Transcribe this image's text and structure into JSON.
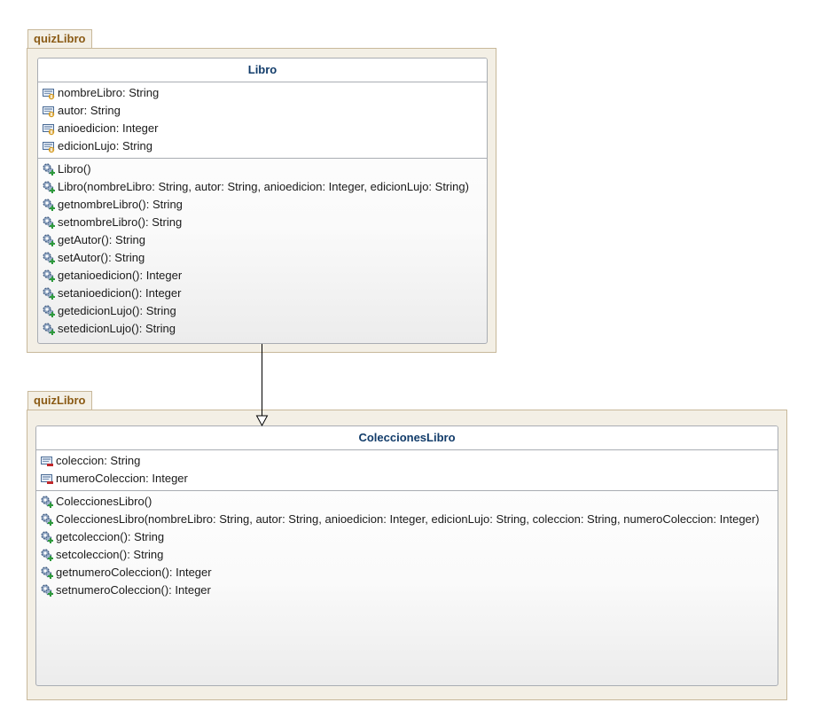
{
  "packages": [
    {
      "name": "quizLibro",
      "class": {
        "name": "Libro",
        "attributes": [
          {
            "text": "nombreLibro: String",
            "visibility": "protected"
          },
          {
            "text": "autor: String",
            "visibility": "protected"
          },
          {
            "text": "anioedicion: Integer",
            "visibility": "protected"
          },
          {
            "text": "edicionLujo: String",
            "visibility": "protected"
          }
        ],
        "operations": [
          "Libro()",
          "Libro(nombreLibro: String, autor: String, anioedicion: Integer, edicionLujo: String)",
          "getnombreLibro(): String",
          "setnombreLibro(): String",
          "getAutor(): String",
          "setAutor(): String",
          "getanioedicion(): Integer",
          "setanioedicion(): Integer",
          "getedicionLujo(): String",
          "setedicionLujo(): String"
        ]
      }
    },
    {
      "name": "quizLibro",
      "class": {
        "name": "ColeccionesLibro",
        "attributes": [
          {
            "text": "coleccion: String",
            "visibility": "private"
          },
          {
            "text": "numeroColeccion: Integer",
            "visibility": "private"
          }
        ],
        "operations": [
          "ColeccionesLibro()",
          "ColeccionesLibro(nombreLibro: String, autor: String, anioedicion: Integer, edicionLujo: String, coleccion: String, numeroColeccion: Integer)",
          "getcoleccion(): String",
          "setcoleccion(): String",
          "getnumeroColeccion(): Integer",
          "setnumeroColeccion(): Integer"
        ]
      }
    }
  ],
  "relationships": [
    {
      "type": "generalization",
      "from": "ColeccionesLibro",
      "to": "Libro"
    }
  ],
  "colors": {
    "package_fill": "#f3efe5",
    "package_border": "#c8b89a",
    "package_title": "#8a5a14",
    "class_title": "#123c6a",
    "field_protected_badge": "#d49a1f",
    "field_private_badge": "#c0282b",
    "method_public_badge": "#2e9a3c"
  }
}
